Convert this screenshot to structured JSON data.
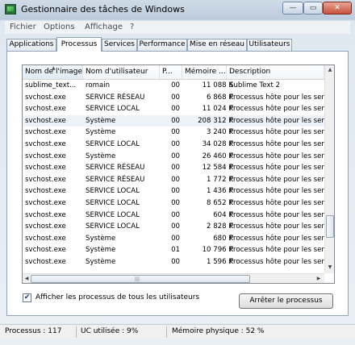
{
  "window": {
    "title": "Gestionnaire des tâches de Windows",
    "min_label": "—",
    "max_label": "▭",
    "close_label": "✕"
  },
  "menu": [
    "Fichier",
    "Options",
    "Affichage",
    "?"
  ],
  "tabs": [
    "Applications",
    "Processus",
    "Services",
    "Performance",
    "Mise en réseau",
    "Utilisateurs"
  ],
  "active_tab": "Processus",
  "columns": [
    "Nom de l'image",
    "Nom d'utilisateur",
    "P...",
    "Mémoire ...",
    "Description"
  ],
  "rows": [
    [
      "sublime_text...",
      "romain",
      "00",
      "11 088 K",
      "Sublime Text 2"
    ],
    [
      "svchost.exe",
      "SERVICE RÉSEAU",
      "00",
      "6 868 K",
      "Processus hôte pour les ser"
    ],
    [
      "svchost.exe",
      "SERVICE LOCAL",
      "00",
      "11 024 K",
      "Processus hôte pour les ser"
    ],
    [
      "svchost.exe",
      "Système",
      "00",
      "208 312 K",
      "Processus hôte pour les ser"
    ],
    [
      "svchost.exe",
      "Système",
      "00",
      "3 240 K",
      "Processus hôte pour les ser"
    ],
    [
      "svchost.exe",
      "SERVICE LOCAL",
      "00",
      "34 028 K",
      "Processus hôte pour les ser"
    ],
    [
      "svchost.exe",
      "Système",
      "00",
      "26 460 K",
      "Processus hôte pour les ser"
    ],
    [
      "svchost.exe",
      "SERVICE RÉSEAU",
      "00",
      "12 584 K",
      "Processus hôte pour les ser"
    ],
    [
      "svchost.exe",
      "SERVICE RÉSEAU",
      "00",
      "1 772 K",
      "Processus hôte pour les ser"
    ],
    [
      "svchost.exe",
      "SERVICE LOCAL",
      "00",
      "1 436 K",
      "Processus hôte pour les ser"
    ],
    [
      "svchost.exe",
      "SERVICE LOCAL",
      "00",
      "8 652 K",
      "Processus hôte pour les ser"
    ],
    [
      "svchost.exe",
      "SERVICE LOCAL",
      "00",
      "604 K",
      "Processus hôte pour les ser"
    ],
    [
      "svchost.exe",
      "SERVICE LOCAL",
      "00",
      "2 828 K",
      "Processus hôte pour les ser"
    ],
    [
      "svchost.exe",
      "Système",
      "00",
      "680 K",
      "Processus hôte pour les ser"
    ],
    [
      "svchost.exe",
      "Système",
      "01",
      "10 796 K",
      "Processus hôte pour les ser"
    ],
    [
      "svchost.exe",
      "Système",
      "00",
      "1 596 K",
      "Processus hôte pour les ser"
    ]
  ],
  "selected_row": 3,
  "show_all_checkbox": {
    "label": "Afficher les processus de tous les utilisateurs",
    "checked": true
  },
  "end_process_button": "Arrêter le processus",
  "status": {
    "processes": "Processus : 117",
    "cpu": "UC utilisée : 9%",
    "memory": "Mémoire physique : 52 %"
  }
}
